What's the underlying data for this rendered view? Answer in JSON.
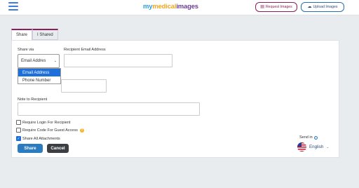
{
  "header": {
    "logo": {
      "part1": "my",
      "part2": "medical",
      "part3": "images"
    },
    "request_label": "Request Images",
    "upload_label": "Upload Images"
  },
  "tabs": [
    {
      "label": "Share"
    },
    {
      "label": "I Shared"
    }
  ],
  "form": {
    "share_via_label": "Share via",
    "share_via_value": "Email Addres",
    "options": [
      "Email Address",
      "Phone Number"
    ],
    "recipient_label": "Recipient Email Address",
    "note_label": "Note to Recipient",
    "checkboxes": [
      {
        "label": "Require Login For Recipient",
        "checked": false
      },
      {
        "label": "Require Code For Guest Access",
        "checked": false
      },
      {
        "label": "Share All Attachments",
        "checked": true
      }
    ],
    "share_button": "Share",
    "cancel_button": "Cancel"
  },
  "language": {
    "send_in_label": "Send in",
    "current": "English"
  },
  "colors": {
    "primary": "#2a7bbf",
    "accent": "#8b1e5c",
    "selected_option": "#1e6fd9",
    "dark_button": "#3b3f44"
  },
  "icons": {
    "menu": "hamburger-icon",
    "request": "image-icon",
    "upload": "cloud-upload-icon",
    "help": "question-icon",
    "info": "info-icon",
    "flag": "us-flag-icon",
    "chevron": "chevron-down-icon"
  }
}
